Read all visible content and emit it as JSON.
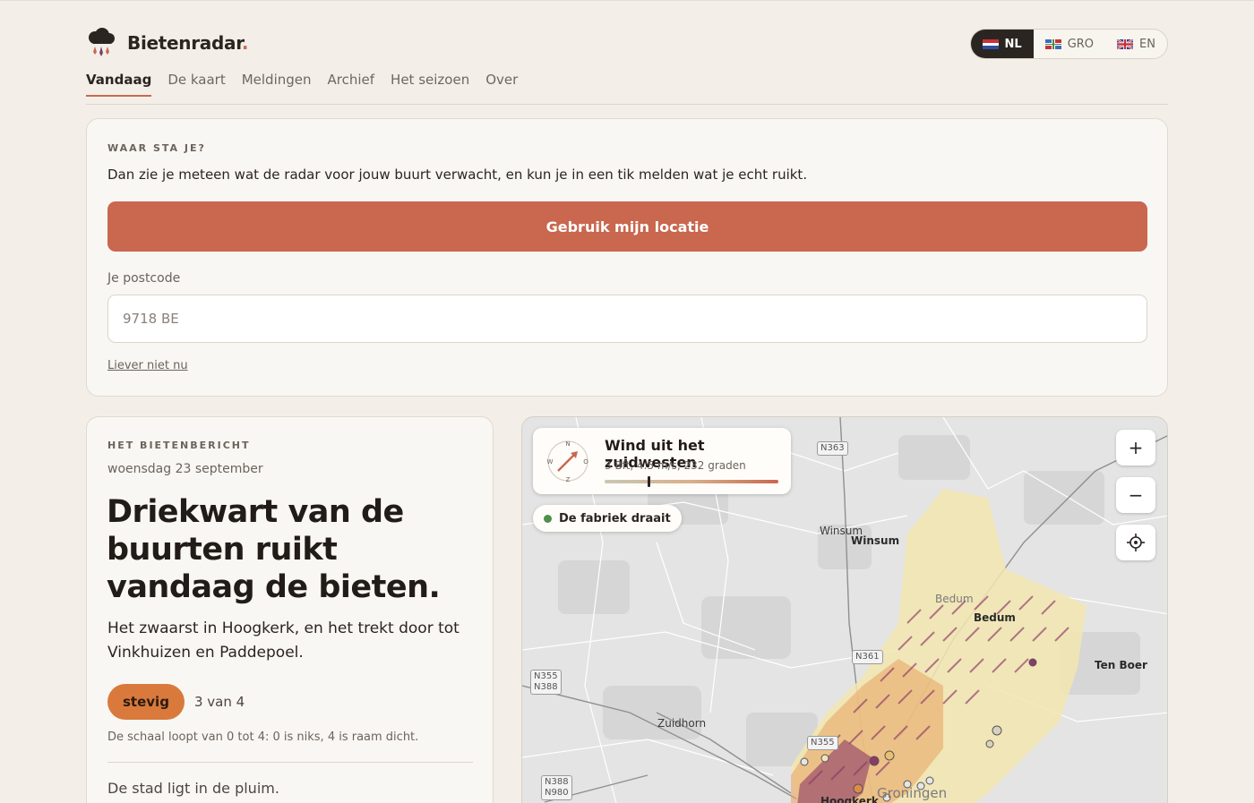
{
  "brand": {
    "name": "Bietenradar",
    "dot": ".",
    "logo_icon": "cloud-drops-icon"
  },
  "languages": [
    {
      "code": "NL",
      "active": true,
      "flag": "nl-flag-icon"
    },
    {
      "code": "GRO",
      "active": false,
      "flag": "groningen-flag-icon"
    },
    {
      "code": "EN",
      "active": false,
      "flag": "uk-flag-icon"
    }
  ],
  "nav": {
    "tabs": [
      {
        "label": "Vandaag",
        "active": true
      },
      {
        "label": "De kaart",
        "active": false
      },
      {
        "label": "Meldingen",
        "active": false
      },
      {
        "label": "Archief",
        "active": false
      },
      {
        "label": "Het seizoen",
        "active": false
      },
      {
        "label": "Over",
        "active": false
      }
    ]
  },
  "location": {
    "eyebrow": "WAAR STA JE?",
    "description": "Dan zie je meteen wat de radar voor jouw buurt verwacht, en kun je in een tik melden wat je echt ruikt.",
    "use_location_label": "Gebruik mijn locatie",
    "postcode_label": "Je postcode",
    "postcode_placeholder": "9718 BE",
    "later_link": "Liever niet nu"
  },
  "report": {
    "eyebrow": "HET BIETENBERICHT",
    "date": "woensdag 23 september",
    "headline": "Driekwart van de buurten ruikt vandaag de bieten.",
    "summary": "Het zwaarst in Hoogkerk, en het trekt door tot Vinkhuizen en Paddepoel.",
    "level_label": "stevig",
    "level_count": "3 van 4",
    "level_value": 3,
    "level_max": 4,
    "scale_note": "De schaal loopt van 0 tot 4: 0 is niks, 4 is raam dicht.",
    "plume_line": "De stad ligt in de pluim."
  },
  "map": {
    "wind": {
      "title": "Wind uit het zuidwesten",
      "subtitle": "3 Bft, 4.5 m/s, 232 graden",
      "bft": 3,
      "compass": {
        "n": "N",
        "o": "O",
        "z": "Z",
        "w": "W"
      }
    },
    "factory_status": "De fabriek draait",
    "controls": {
      "zoom_in": "+",
      "zoom_out": "−"
    },
    "places": {
      "winsum_base": "Winsum",
      "winsum": "Winsum",
      "bedum_base": "Bedum",
      "bedum": "Bedum",
      "ten_boer": "Ten Boer",
      "zuidhorn": "Zuidhorn",
      "groningen": "Groningen",
      "hoogkerk": "Hoogkerk"
    },
    "roads": {
      "n363": "N363",
      "n361": "N361",
      "n355_n388": [
        "N355",
        "N388"
      ],
      "n355": "N355",
      "n388_n980": [
        "N388",
        "N980"
      ]
    },
    "colors": {
      "plume_light": "#f3e6b0",
      "plume_mid": "#e8a25f",
      "plume_dark": "#8c3a68",
      "accent": "#c9674f"
    }
  }
}
